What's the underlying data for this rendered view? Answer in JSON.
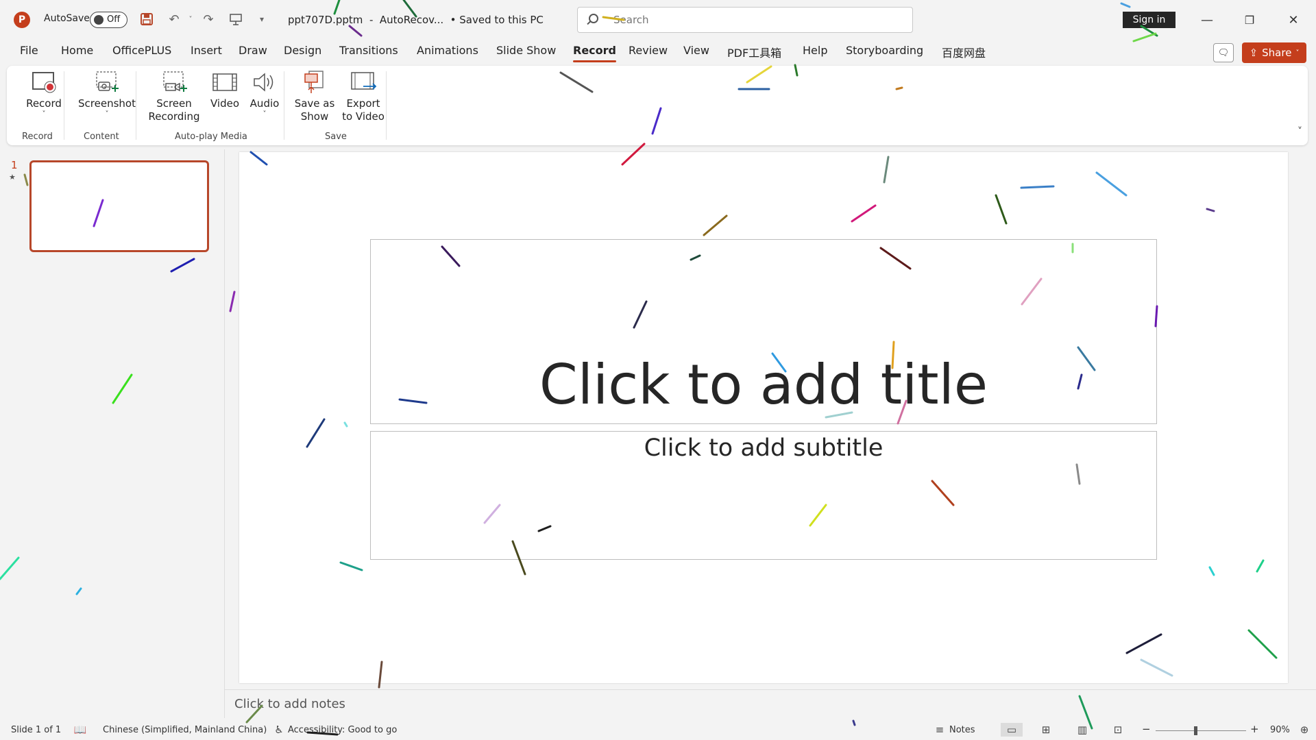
{
  "app": {
    "logo_letter": "P",
    "autosave_label": "AutoSave",
    "autosave_state": "Off",
    "document_title": "ppt707D.pptm  -  AutoRecov...  • Saved to this PC",
    "search_placeholder": "Search",
    "sign_in_label": "Sign in",
    "share_label": "Share",
    "accent_color": "#c43e1c"
  },
  "menu": {
    "tabs": [
      {
        "label": "File"
      },
      {
        "label": "Home"
      },
      {
        "label": "OfficePLUS"
      },
      {
        "label": "Insert"
      },
      {
        "label": "Draw"
      },
      {
        "label": "Design"
      },
      {
        "label": "Transitions"
      },
      {
        "label": "Animations"
      },
      {
        "label": "Slide Show"
      },
      {
        "label": "Record"
      },
      {
        "label": "Review"
      },
      {
        "label": "View"
      },
      {
        "label": "PDF工具箱"
      },
      {
        "label": "Help"
      },
      {
        "label": "Storyboarding"
      },
      {
        "label": "百度网盘"
      }
    ],
    "active_tab": "Record"
  },
  "ribbon": {
    "buttons": {
      "record": {
        "line1": "Record",
        "caret": "˅"
      },
      "screenshot": {
        "line1": "Screenshot",
        "caret": "˅"
      },
      "screen_recording": {
        "line1": "Screen",
        "line2": "Recording"
      },
      "video": {
        "line1": "Video"
      },
      "audio": {
        "line1": "Audio",
        "caret": "˅"
      },
      "save_as_show": {
        "line1": "Save as",
        "line2": "Show"
      },
      "export_video": {
        "line1": "Export",
        "line2": "to Video"
      }
    },
    "groups": {
      "record": "Record",
      "content": "Content",
      "auto_play_media": "Auto-play Media",
      "save": "Save"
    }
  },
  "thumbnails": {
    "slide_number": "1",
    "star": "★"
  },
  "slide": {
    "title_placeholder": "Click to add title",
    "subtitle_placeholder": "Click to add subtitle"
  },
  "notes": {
    "placeholder": "Click to add notes"
  },
  "status": {
    "slide_info": "Slide 1 of 1",
    "language": "Chinese (Simplified, Mainland China)",
    "accessibility": "Accessibility: Good to go",
    "notes_label": "Notes",
    "zoom_minus": "−",
    "zoom_plus": "+",
    "zoom_level": "90%"
  }
}
